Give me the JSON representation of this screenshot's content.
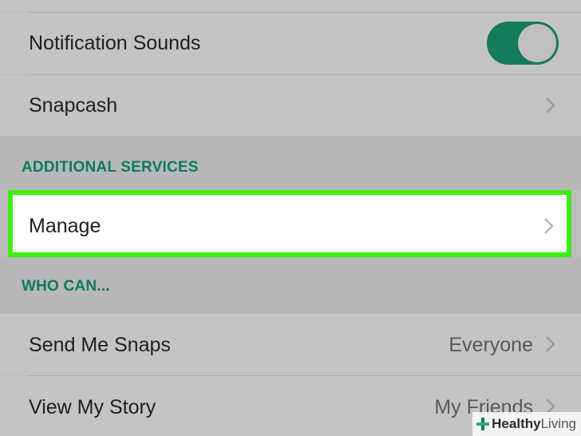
{
  "settings": {
    "notification_sounds": {
      "label": "Notification Sounds",
      "enabled": true
    },
    "snapcash": {
      "label": "Snapcash"
    },
    "additional_services": {
      "header": "ADDITIONAL SERVICES",
      "manage": {
        "label": "Manage"
      }
    },
    "who_can": {
      "header": "WHO CAN...",
      "send_me_snaps": {
        "label": "Send Me Snaps",
        "value": "Everyone"
      },
      "view_my_story": {
        "label": "View My Story",
        "value": "My Friends"
      }
    }
  },
  "watermark": {
    "brand_bold": "Healthy",
    "brand_light": "Living"
  },
  "colors": {
    "accent": "#0d7a63",
    "toggle_on": "#157a5e",
    "highlight_border": "#3df012"
  }
}
